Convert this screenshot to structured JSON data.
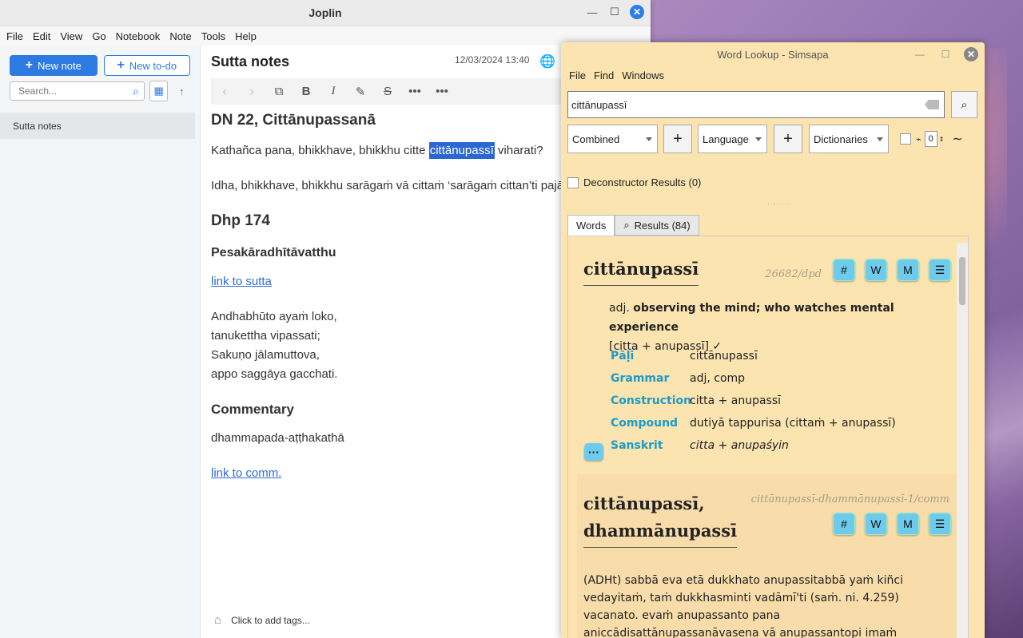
{
  "joplin": {
    "title": "Joplin",
    "menu": [
      "File",
      "Edit",
      "View",
      "Go",
      "Notebook",
      "Note",
      "Tools",
      "Help"
    ],
    "new_note": "New note",
    "new_todo": "New to-do",
    "search_placeholder": "Search...",
    "notes": [
      "Sutta notes"
    ],
    "note_title": "Sutta notes",
    "note_date": "12/03/2024 13:40",
    "content": {
      "h1": "DN 22, Cittānupassanā",
      "p1_before": "Kathañca pana, bhikkhave, bhikkhu citte ",
      "p1_hl": "cittānupassī",
      "p1_after": " viharati?",
      "p2": "Idha, bhikkhave, bhikkhu sarāgaṁ vā cittaṁ ‘sarāgaṁ cittan’ti pajā",
      "h2": "Dhp 174",
      "h3": "Pesakāradhītāvatthu",
      "link1": "link to sutta",
      "verse": [
        "Andhabhūto ayaṁ loko,",
        "tanukettha vipassati;",
        "Sakuṇo jālamuttova,",
        "appo saggāya gacchati."
      ],
      "h2b": "Commentary",
      "p3": "dhammapada-aṭṭhakathā",
      "link2": "link to comm."
    },
    "tags_label": "Click to add tags..."
  },
  "simsapa": {
    "title": "Word Lookup - Simsapa",
    "menu": [
      "File",
      "Find",
      "Windows"
    ],
    "query": "cittānupassī",
    "filters": {
      "mode": "Combined",
      "language": "Language",
      "dictionaries": "Dictionaries",
      "count": "0"
    },
    "deconstructor": "Deconstructor Results (0)",
    "tabs": {
      "words": "Words",
      "results": "Results (84)"
    },
    "entry1": {
      "headword": "cittānupassī",
      "uid": "26682/dpd",
      "pos": "adj.",
      "meaning": "observing the mind; who watches mental experience",
      "construction_line": "[citta + anupassī] ✓",
      "rows": [
        {
          "k": "Pāḷi",
          "v": "cittānupassī"
        },
        {
          "k": "Grammar",
          "v": "adj, comp"
        },
        {
          "k": "Construction",
          "v": "citta + anupassī"
        },
        {
          "k": "Compound",
          "v": "dutiyā tappurisa (cittaṁ + anupassī)"
        },
        {
          "k": "Sanskrit",
          "v": "citta + anupaśyin"
        }
      ]
    },
    "entry2": {
      "headword1": "cittānupassī,",
      "headword2": "dhammānupassī",
      "uid": "cittānupassī-dhammānupassī-1/comm",
      "text": "(ADHt) sabbā eva etā dukkhato anupassitabbā yaṁ kiñci vedayitaṁ, taṁ dukkhasminti vadāmī'ti (saṁ. ni. 4.259) vacanato. evaṁ anupassanto pana aniccādisattānupassanāvasena vā anupassantopi imaṁ vedanaṁ ko vedayati, kassāyaṁ vedanā, kiṁ kāraṇāyaṁ"
    },
    "badges": [
      "#",
      "W",
      "M",
      "☰"
    ]
  }
}
